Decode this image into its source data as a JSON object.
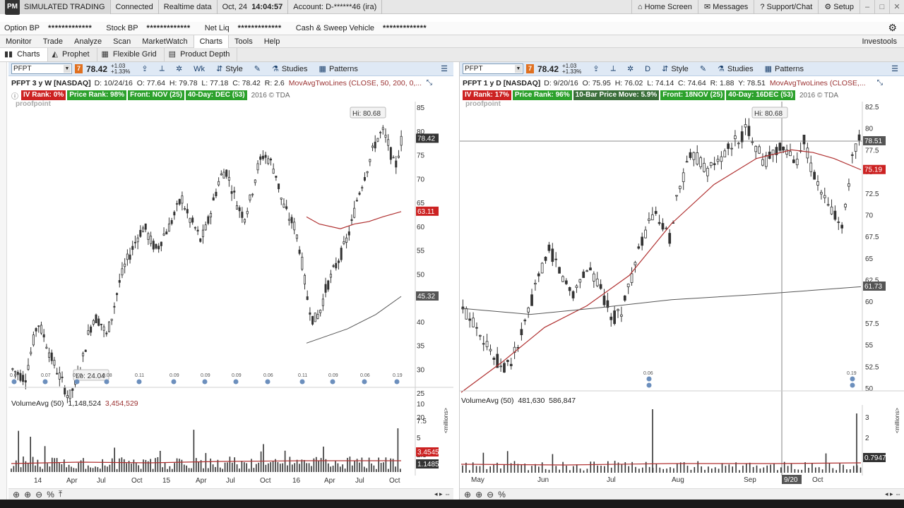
{
  "titlebar": {
    "logo": "PM",
    "mode": "SIMULATED TRADING",
    "connection": "Connected",
    "data_feed": "Realtime data",
    "date": "Oct, 24",
    "time": "14:04:57",
    "account": "Account: D-******46 (ira)",
    "home_screen": "Home Screen",
    "messages": "Messages",
    "support": "Support/Chat",
    "setup": "Setup"
  },
  "balances": {
    "option_bp_label": "Option BP",
    "option_bp_value": "*************",
    "stock_bp_label": "Stock BP",
    "stock_bp_value": "*************",
    "net_liq_label": "Net Liq",
    "net_liq_value": "*************",
    "cash_sweep_label": "Cash & Sweep Vehicle",
    "cash_sweep_value": "*************"
  },
  "menu": {
    "items": [
      "Monitor",
      "Trade",
      "Analyze",
      "Scan",
      "MarketWatch",
      "Charts",
      "Tools",
      "Help"
    ],
    "active": "Charts",
    "investools": "Investools"
  },
  "subtabs": [
    "Charts",
    "Prophet",
    "Flexible Grid",
    "Product Depth"
  ],
  "left_chart": {
    "symbol": "PFPT",
    "price": "78.42",
    "change": "+1.03",
    "change_pct": "+1.33%",
    "aggregation": "Wk",
    "style": "Style",
    "studies": "Studies",
    "patterns": "Patterns",
    "title": "PFPT 3 y W [NASDAQ]",
    "date": "D: 10/24/16",
    "open": "O: 77.64",
    "high": "H: 79.78",
    "low": "L: 77.18",
    "close": "C: 78.42",
    "range": "R: 2.6",
    "study": "MovAvgTwoLines (CLOSE, 50, 200, 0,...",
    "badges": [
      "IV Rank: 0%",
      "Price Rank: 98%",
      "Front: NOV (25)",
      "40-Day: DEC (53)"
    ],
    "copyright": "2016 © TDA",
    "watermark": "proofpoint",
    "hi_label": "Hi: 80.68",
    "lo_label": "Lo: 24.04",
    "price_tag": "78.42",
    "ma50_tag": "63.11",
    "ma200_tag": "45.32",
    "y_ticks": [
      "85",
      "80",
      "75",
      "70",
      "65",
      "60",
      "55",
      "50",
      "45",
      "40",
      "35",
      "30",
      "25",
      "20"
    ],
    "x_labels": [
      "14",
      "Apr",
      "Jul",
      "Oct",
      "15",
      "Apr",
      "Jul",
      "Oct",
      "16",
      "Apr",
      "Jul",
      "Oct"
    ],
    "event_labels": [
      "0.07",
      "0.07",
      "0.08",
      "0.08",
      "0.11",
      "0.09",
      "0.09",
      "0.09",
      "0.06",
      "0.11",
      "0.09",
      "0.06",
      "0.19"
    ],
    "volume_label": "VolumeAvg (50)",
    "volume_value": "1,148,524",
    "volume_avg": "3,454,529",
    "vol_ticks": [
      "10",
      "7.5",
      "5",
      "2.5"
    ],
    "vol_tag_avg": "3.45453",
    "vol_tag_cur": "1.14852",
    "vol_unit": "<millions>"
  },
  "right_chart": {
    "symbol": "PFPT",
    "price": "78.42",
    "change": "+1.03",
    "change_pct": "+1.33%",
    "aggregation": "D",
    "style": "Style",
    "studies": "Studies",
    "patterns": "Patterns",
    "title": "PFPT 1 y D [NASDAQ]",
    "date": "D: 9/20/16",
    "open": "O: 75.95",
    "high": "H: 76.02",
    "low": "L: 74.14",
    "close": "C: 74.64",
    "range": "R: 1.88",
    "last": "Y: 78.51",
    "study": "MovAvgTwoLines (CLOSE,...",
    "badges": [
      "IV Rank: 17%",
      "Price Rank: 96%",
      "10-Bar Price Move: 5.9%",
      "Front: 18NOV (25)",
      "40-Day: 16DEC (53)"
    ],
    "copyright": "2016 © TDA",
    "watermark": "proofpoint",
    "hi_label": "Hi: 80.68",
    "crosshair_price": "78.51",
    "ma50_tag": "75.19",
    "ma200_tag": "61.73",
    "crosshair_date": "9/20",
    "y_ticks": [
      "82.5",
      "80",
      "77.5",
      "75",
      "72.5",
      "70",
      "67.5",
      "65",
      "62.5",
      "60",
      "57.5",
      "55",
      "52.5",
      "50"
    ],
    "x_labels": [
      "May",
      "Jun",
      "Jul",
      "Aug",
      "Sep",
      "Oct"
    ],
    "event_labels": [
      "0.06",
      "0.19"
    ],
    "volume_label": "VolumeAvg (50)",
    "volume_value": "481,630",
    "volume_avg": "586,847",
    "vol_ticks": [
      "3",
      "2",
      "1"
    ],
    "vol_tag": "0.79475",
    "vol_unit": "<millions>"
  },
  "colors": {
    "up": "#333333",
    "down": "#333333",
    "ma50": "#b03030",
    "ma200": "#555555",
    "price_tag_bg": "#333333",
    "ma_tag_bg": "#cc2222",
    "toolbar_bg": "#dfe9f5"
  }
}
